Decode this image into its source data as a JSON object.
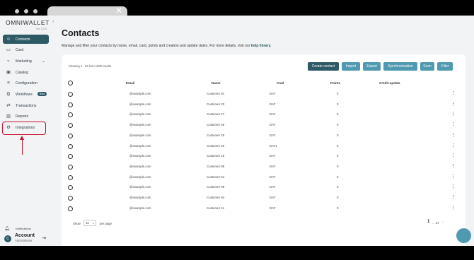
{
  "window": {
    "close_icon": "close-icon"
  },
  "brand": {
    "logo": "OMNIWALLET",
    "sub": "Ver. 2.0.0"
  },
  "sidebar": {
    "items": [
      {
        "label": "Contacts",
        "icon": "contacts-icon",
        "glyph": "☺",
        "active": true
      },
      {
        "label": "Card",
        "icon": "card-icon",
        "glyph": "▭"
      },
      {
        "label": "Marketing",
        "icon": "megaphone-icon",
        "glyph": "⌁",
        "chevron": "⌄"
      },
      {
        "label": "Catalog",
        "icon": "gift-icon",
        "glyph": "▣"
      },
      {
        "label": "Configuration",
        "icon": "sliders-icon",
        "glyph": "≡"
      },
      {
        "label": "Workflows",
        "icon": "workflow-icon",
        "glyph": "⧉",
        "badge": "Beta"
      },
      {
        "label": "Transactions",
        "icon": "transactions-icon",
        "glyph": "⇄"
      },
      {
        "label": "Reports",
        "icon": "reports-icon",
        "glyph": "▥"
      },
      {
        "label": "Integrations",
        "icon": "integrations-icon",
        "glyph": "⚙"
      }
    ],
    "notifications": "Notifications",
    "account": {
      "name": "Account",
      "role": "Administrator",
      "avatar": "C"
    }
  },
  "page": {
    "title": "Contacts",
    "description": "Manage and filter your contacts by name, email, card, points and creation and update dates. For more details, visit our",
    "link": "help library."
  },
  "table": {
    "showing": "Showing 1 - 12 from 1000 results",
    "buttons": [
      "Create contact",
      "Import",
      "Export",
      "Synchronization",
      "Scan",
      "Filter"
    ],
    "headers": [
      "Email",
      "Name",
      "Card",
      "Points",
      "Credit update"
    ],
    "rows": [
      {
        "email": "@example.com",
        "name": "Customer 91",
        "card": "DAT",
        "points": "0"
      },
      {
        "email": "@example.com",
        "name": "Customer 23",
        "card": "DAT",
        "points": "0"
      },
      {
        "email": "@example.com",
        "name": "Customer 27",
        "card": "DAT",
        "points": "0"
      },
      {
        "email": "@example.com",
        "name": "Customer 55",
        "card": "DAT",
        "points": "0"
      },
      {
        "email": "@example.com",
        "name": "Customer 25",
        "card": "DAT",
        "points": "0"
      },
      {
        "email": "@example.com",
        "name": "Customer 20",
        "card": "DAT1",
        "points": "0"
      },
      {
        "email": "@example.com",
        "name": "Customer 18",
        "card": "DAT",
        "points": "0"
      },
      {
        "email": "@example.com",
        "name": "Customer 88",
        "card": "DAT",
        "points": "0"
      },
      {
        "email": "@example.com",
        "name": "Customer 64",
        "card": "DAT",
        "points": "0"
      },
      {
        "email": "@example.com",
        "name": "Customer 98",
        "card": "DAT",
        "points": "0"
      },
      {
        "email": "@example.com",
        "name": "Customer 93",
        "card": "DAT",
        "points": "0"
      },
      {
        "email": "@example.com",
        "name": "Customer 41",
        "card": "DAT",
        "points": "0"
      }
    ],
    "footer": {
      "show": "Show",
      "per_page_value": "12",
      "per_page": "per page",
      "page": "1",
      "page_total": "... 84",
      "next": "›"
    }
  },
  "colors": {
    "brand": "#2e5a66",
    "accent": "#4f9ab0",
    "annotation": "#c8102e"
  }
}
